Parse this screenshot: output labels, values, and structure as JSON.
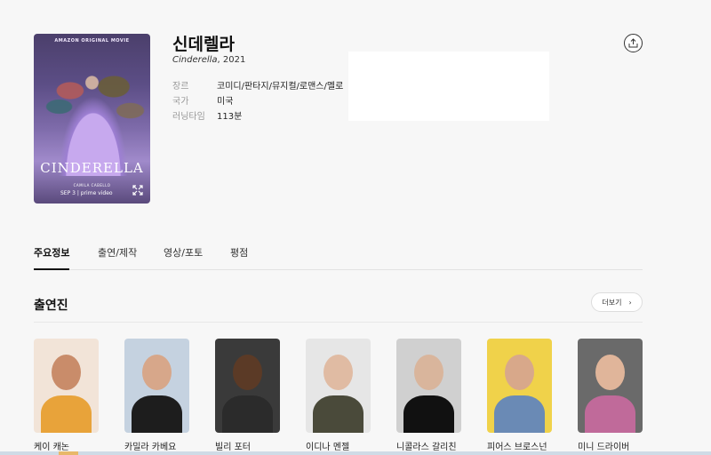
{
  "poster": {
    "top_text": "AMAZON ORIGINAL MOVIE",
    "star": "CAMILA CABELLO",
    "title": "CINDERELLA",
    "bottom": "SEP 3 | prime video"
  },
  "movie": {
    "title": "신데렐라",
    "original_title": "Cinderella",
    "year": ", 2021",
    "info": [
      {
        "label": "장르",
        "value": "코미디/판타지/뮤지컬/로맨스/멜로"
      },
      {
        "label": "국가",
        "value": "미국"
      },
      {
        "label": "러닝타임",
        "value": "113분"
      }
    ]
  },
  "tabs": [
    "주요정보",
    "출연/제작",
    "영상/포토",
    "평점"
  ],
  "cast_section": {
    "title": "출연진",
    "more_label": "더보기"
  },
  "cast": [
    {
      "name": "케이 캐논",
      "bg": "#f2e4d8",
      "face": "#c98c6a",
      "body": "#e8a33a"
    },
    {
      "name": "카밀라 카베요",
      "bg": "#c5d2e0",
      "face": "#d7a78a",
      "body": "#1d1d1d"
    },
    {
      "name": "빌리 포터",
      "bg": "#3a3a3a",
      "face": "#5b3a26",
      "body": "#2b2b2b"
    },
    {
      "name": "이디나 멘젤",
      "bg": "#e6e6e6",
      "face": "#e0bba3",
      "body": "#4a4a3a"
    },
    {
      "name": "니콜라스 갈리친",
      "bg": "#d0d0d0",
      "face": "#d9b59c",
      "body": "#111111"
    },
    {
      "name": "피어스 브로스넌",
      "bg": "#f0d24a",
      "face": "#d8a88a",
      "body": "#6a8ab5"
    },
    {
      "name": "미니 드라이버",
      "bg": "#6a6a6a",
      "face": "#e0b59a",
      "body": "#c06a9a"
    }
  ]
}
